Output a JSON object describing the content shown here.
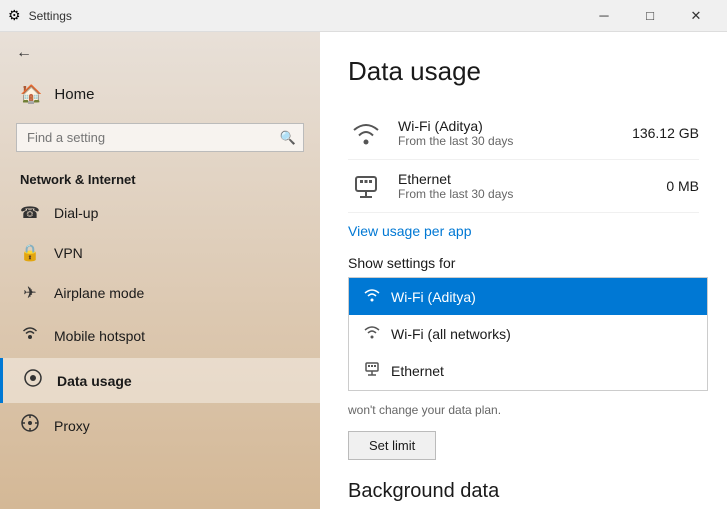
{
  "titlebar": {
    "title": "Settings",
    "minimize_label": "─",
    "maximize_label": "□",
    "close_label": "✕"
  },
  "sidebar": {
    "back_label": "",
    "home_label": "Home",
    "search_placeholder": "Find a setting",
    "section_title": "Network & Internet",
    "items": [
      {
        "id": "dialup",
        "label": "Dial-up",
        "icon": "📞"
      },
      {
        "id": "vpn",
        "label": "VPN",
        "icon": "🔗"
      },
      {
        "id": "airplane",
        "label": "Airplane mode",
        "icon": "✈"
      },
      {
        "id": "hotspot",
        "label": "Mobile hotspot",
        "icon": "📶"
      },
      {
        "id": "datausage",
        "label": "Data usage",
        "icon": "⊙",
        "active": true
      },
      {
        "id": "proxy",
        "label": "Proxy",
        "icon": "⚙"
      }
    ]
  },
  "main": {
    "page_title": "Data usage",
    "usage_items": [
      {
        "id": "wifi",
        "name": "Wi-Fi (Aditya)",
        "sub": "From the last 30 days",
        "amount": "136.12 GB",
        "icon_type": "wifi"
      },
      {
        "id": "ethernet",
        "name": "Ethernet",
        "sub": "From the last 30 days",
        "amount": "0 MB",
        "icon_type": "ethernet"
      }
    ],
    "view_usage_link": "View usage per app",
    "show_settings_label": "Show settings for",
    "dropdown_items": [
      {
        "id": "wifi-aditya",
        "label": "Wi-Fi (Aditya)",
        "selected": true,
        "icon_type": "wifi"
      },
      {
        "id": "wifi-all",
        "label": "Wi-Fi (all networks)",
        "selected": false,
        "icon_type": "wifi"
      },
      {
        "id": "ethernet",
        "label": "Ethernet",
        "selected": false,
        "icon_type": "ethernet"
      }
    ],
    "wont_change_text": "won't change your data plan.",
    "set_limit_label": "Set limit",
    "bg_data_title": "Background data"
  },
  "colors": {
    "accent": "#0078d4",
    "selected_bg": "#0078d4"
  }
}
